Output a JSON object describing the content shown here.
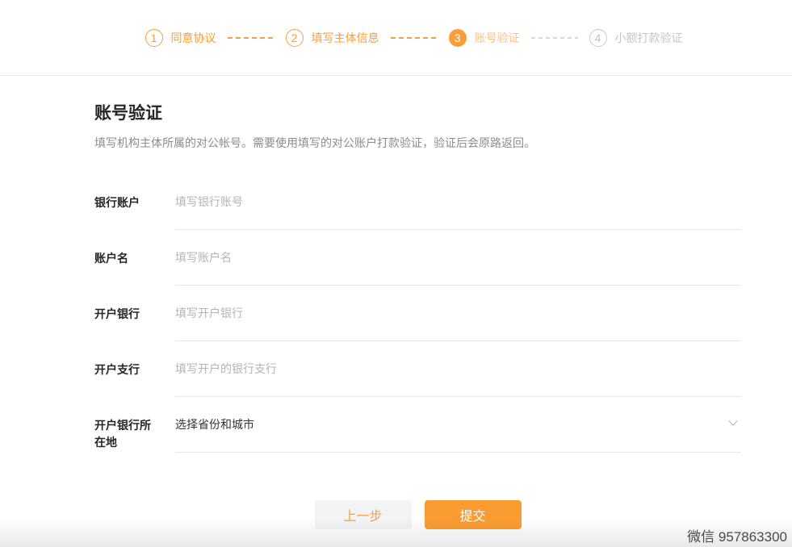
{
  "stepper": {
    "steps": [
      {
        "number": "1",
        "label": "同意协议",
        "state": "done"
      },
      {
        "number": "2",
        "label": "填写主体信息",
        "state": "done"
      },
      {
        "number": "3",
        "label": "账号验证",
        "state": "current"
      },
      {
        "number": "4",
        "label": "小额打款验证",
        "state": "pending"
      }
    ]
  },
  "section": {
    "title": "账号验证",
    "description": "填写机构主体所属的对公帐号。需要使用填写的对公账户打款验证，验证后会原路返回。"
  },
  "form": {
    "fields": [
      {
        "label": "银行账户",
        "placeholder": "填写银行账号",
        "type": "input"
      },
      {
        "label": "账户名",
        "placeholder": "填写账户名",
        "type": "input"
      },
      {
        "label": "开户银行",
        "placeholder": "填写开户银行",
        "type": "input"
      },
      {
        "label": "开户支行",
        "placeholder": "填写开户的银行支行",
        "type": "input"
      },
      {
        "label": "开户银行所在地",
        "value": "选择省份和城市",
        "type": "select"
      }
    ]
  },
  "actions": {
    "previous_label": "上一步",
    "submit_label": "提交"
  },
  "watermark": "微信 957863300",
  "colors": {
    "accent_orange": "#fa9d3b",
    "current_step_label": "#fcc184",
    "pending_gray": "#c9c9c9",
    "submit_bg": "#fa9c32",
    "prev_bg": "#f3f4f6",
    "divider": "#e8e8e8",
    "placeholder": "#b4b4b4",
    "title_text": "#262626",
    "desc_text": "#8c8c8c"
  }
}
